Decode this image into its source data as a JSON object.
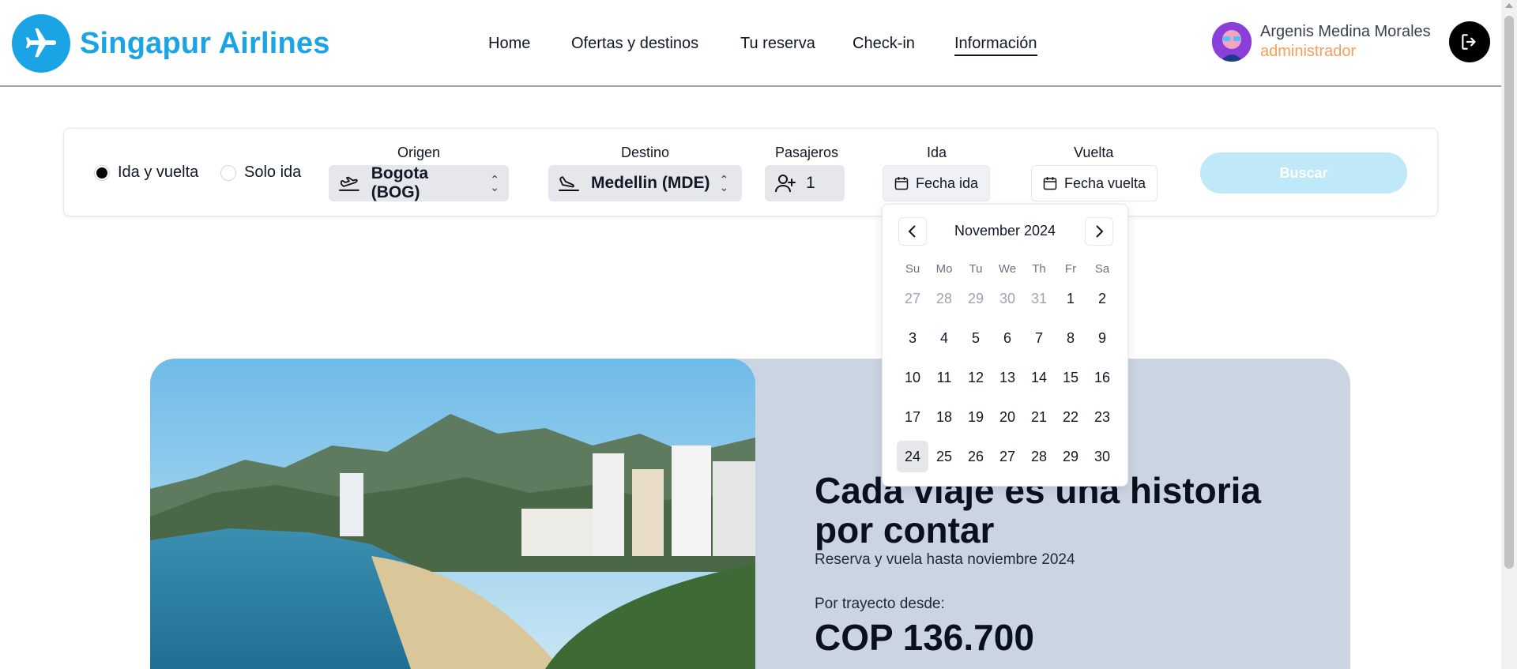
{
  "brand": {
    "name": "Singapur Airlines",
    "color": "#1aa4e6"
  },
  "nav": {
    "items": [
      {
        "label": "Home"
      },
      {
        "label": "Ofertas y destinos"
      },
      {
        "label": "Tu reserva"
      },
      {
        "label": "Check-in"
      },
      {
        "label": "Información",
        "active": true
      }
    ]
  },
  "user": {
    "name": "Argenis Medina Morales",
    "role": "administrador",
    "role_color": "#f59e5b"
  },
  "search": {
    "trip_types": [
      {
        "label": "Ida y vuelta",
        "selected": true
      },
      {
        "label": "Solo ida",
        "selected": false
      }
    ],
    "origin": {
      "label": "Origen",
      "value": "Bogota (BOG)",
      "icon": "takeoff-icon"
    },
    "destination": {
      "label": "Destino",
      "value": "Medellin (MDE)",
      "icon": "landing-icon"
    },
    "passengers": {
      "label": "Pasajeros",
      "value": "1",
      "icon": "user-plus-icon"
    },
    "departure": {
      "label": "Ida",
      "value": "Fecha ida",
      "icon": "calendar-icon"
    },
    "return": {
      "label": "Vuelta",
      "value": "Fecha vuelta",
      "icon": "calendar-icon"
    },
    "button": {
      "label": "Buscar",
      "color": "#bfe8f9"
    }
  },
  "calendar": {
    "month": "November 2024",
    "weekdays": [
      "Su",
      "Mo",
      "Tu",
      "We",
      "Th",
      "Fr",
      "Sa"
    ],
    "weeks": [
      [
        "27",
        "28",
        "29",
        "30",
        "31",
        "1",
        "2"
      ],
      [
        "3",
        "4",
        "5",
        "6",
        "7",
        "8",
        "9"
      ],
      [
        "10",
        "11",
        "12",
        "13",
        "14",
        "15",
        "16"
      ],
      [
        "17",
        "18",
        "19",
        "20",
        "21",
        "22",
        "23"
      ],
      [
        "24",
        "25",
        "26",
        "27",
        "28",
        "29",
        "30"
      ]
    ],
    "outside_month": [
      [
        0,
        0
      ],
      [
        0,
        1
      ],
      [
        0,
        2
      ],
      [
        0,
        3
      ],
      [
        0,
        4
      ]
    ],
    "highlighted": [
      4,
      0
    ]
  },
  "hero": {
    "title": "Cada viaje es una historia por contar",
    "subtitle": "Reserva y vuela hasta noviembre 2024",
    "price_label": "Por trayecto desde:",
    "price": "COP 136.700",
    "background_color": "#cbd5e1"
  }
}
